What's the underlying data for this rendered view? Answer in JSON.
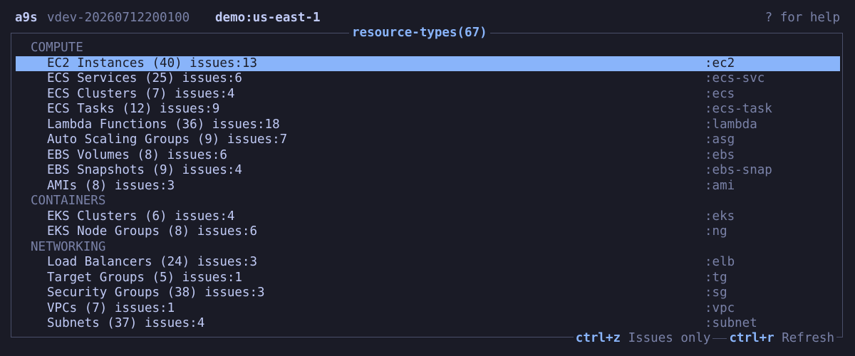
{
  "header": {
    "app_name": "a9s",
    "version": "vdev-20260712200100",
    "profile": "demo:us-east-1",
    "help": "? for help"
  },
  "frame": {
    "title": "resource-types(67)"
  },
  "list": [
    {
      "type": "section",
      "label": "COMPUTE"
    },
    {
      "type": "item",
      "label": "EC2 Instances (40) issues:13",
      "alias": ":ec2",
      "selected": true
    },
    {
      "type": "item",
      "label": "ECS Services (25) issues:6",
      "alias": ":ecs-svc"
    },
    {
      "type": "item",
      "label": "ECS Clusters (7) issues:4",
      "alias": ":ecs"
    },
    {
      "type": "item",
      "label": "ECS Tasks (12) issues:9",
      "alias": ":ecs-task"
    },
    {
      "type": "item",
      "label": "Lambda Functions (36) issues:18",
      "alias": ":lambda"
    },
    {
      "type": "item",
      "label": "Auto Scaling Groups (9) issues:7",
      "alias": ":asg"
    },
    {
      "type": "item",
      "label": "EBS Volumes (8) issues:6",
      "alias": ":ebs"
    },
    {
      "type": "item",
      "label": "EBS Snapshots (9) issues:4",
      "alias": ":ebs-snap"
    },
    {
      "type": "item",
      "label": "AMIs (8) issues:3",
      "alias": ":ami"
    },
    {
      "type": "section",
      "label": "CONTAINERS"
    },
    {
      "type": "item",
      "label": "EKS Clusters (6) issues:4",
      "alias": ":eks"
    },
    {
      "type": "item",
      "label": "EKS Node Groups (8) issues:6",
      "alias": ":ng"
    },
    {
      "type": "section",
      "label": "NETWORKING"
    },
    {
      "type": "item",
      "label": "Load Balancers (24) issues:3",
      "alias": ":elb"
    },
    {
      "type": "item",
      "label": "Target Groups (5) issues:1",
      "alias": ":tg"
    },
    {
      "type": "item",
      "label": "Security Groups (38) issues:3",
      "alias": ":sg"
    },
    {
      "type": "item",
      "label": "VPCs (7) issues:1",
      "alias": ":vpc"
    },
    {
      "type": "item",
      "label": "Subnets (37) issues:4",
      "alias": ":subnet"
    }
  ],
  "footer": {
    "issues_key": "ctrl+z",
    "issues_label": "Issues only",
    "refresh_key": "ctrl+r",
    "refresh_label": "Refresh"
  },
  "colors": {
    "background": "#1a1b26",
    "foreground": "#c0caf5",
    "accent": "#89b4fa",
    "muted": "#7a82a8",
    "border": "#4a4f6a"
  }
}
